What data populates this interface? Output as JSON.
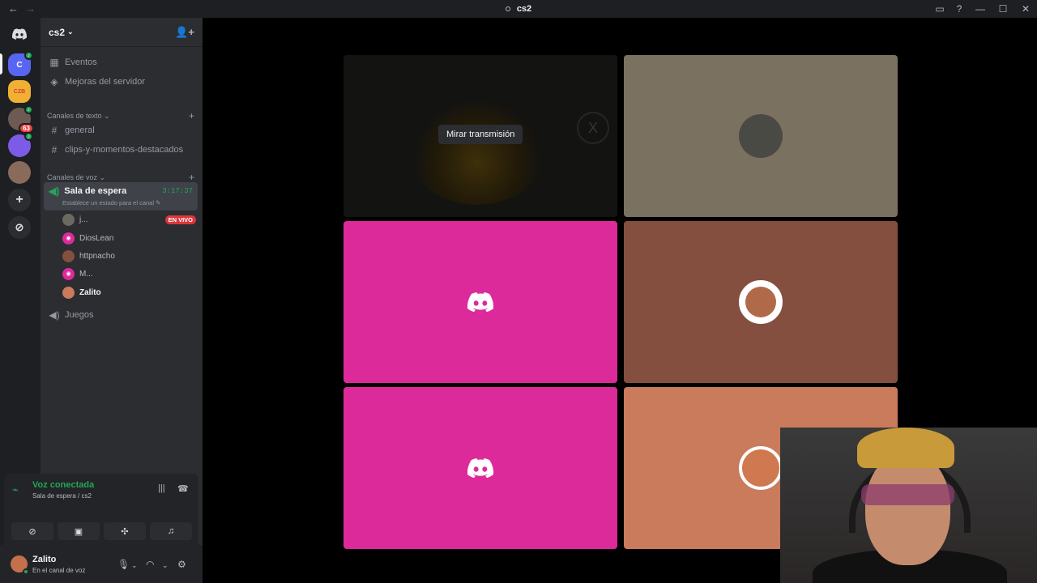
{
  "window": {
    "title": "cs2",
    "back_icon": "←",
    "forward_icon": "→"
  },
  "server": {
    "name": "cs2"
  },
  "servers": [
    {
      "label": "C",
      "color": "#5865f2"
    },
    {
      "label": "CZB",
      "color": "#f0b132"
    },
    {
      "label": "",
      "color": "#6d5a52",
      "count": "63"
    },
    {
      "label": "",
      "color": "#7c5ce6"
    },
    {
      "label": "",
      "color": "#8a6a5a"
    }
  ],
  "nav": {
    "events": "Eventos",
    "boosts": "Mejoras del servidor"
  },
  "text_category": "Canales de texto",
  "text_channels": [
    "general",
    "clips-y-momentos-destacados"
  ],
  "voice_category": "Canales de voz",
  "voice_channel": {
    "name": "Sala de espera",
    "time": "3:17:37",
    "status": "Establece un estado para el canal"
  },
  "members": [
    {
      "name": "j...",
      "live": "EN VIVO"
    },
    {
      "name": "DiosLean"
    },
    {
      "name": "httpnacho"
    },
    {
      "name": "M..."
    },
    {
      "name": "Zalito"
    }
  ],
  "other_voice": "Juegos",
  "voice_panel": {
    "title": "Voz conectada",
    "subtitle": "Sala de espera / cs2"
  },
  "user": {
    "name": "Zalito",
    "status": "En el canal de voz"
  },
  "stream": {
    "watch_label": "Mirar transmisión"
  },
  "tile_colors": [
    "#7b7161",
    "#dd2a9b",
    "#844f3f",
    "#dd2a9b",
    "#c97b5c"
  ],
  "icons": [
    "inbox-icon",
    "help-icon",
    "minimize-icon",
    "maximize-icon",
    "close-icon"
  ]
}
